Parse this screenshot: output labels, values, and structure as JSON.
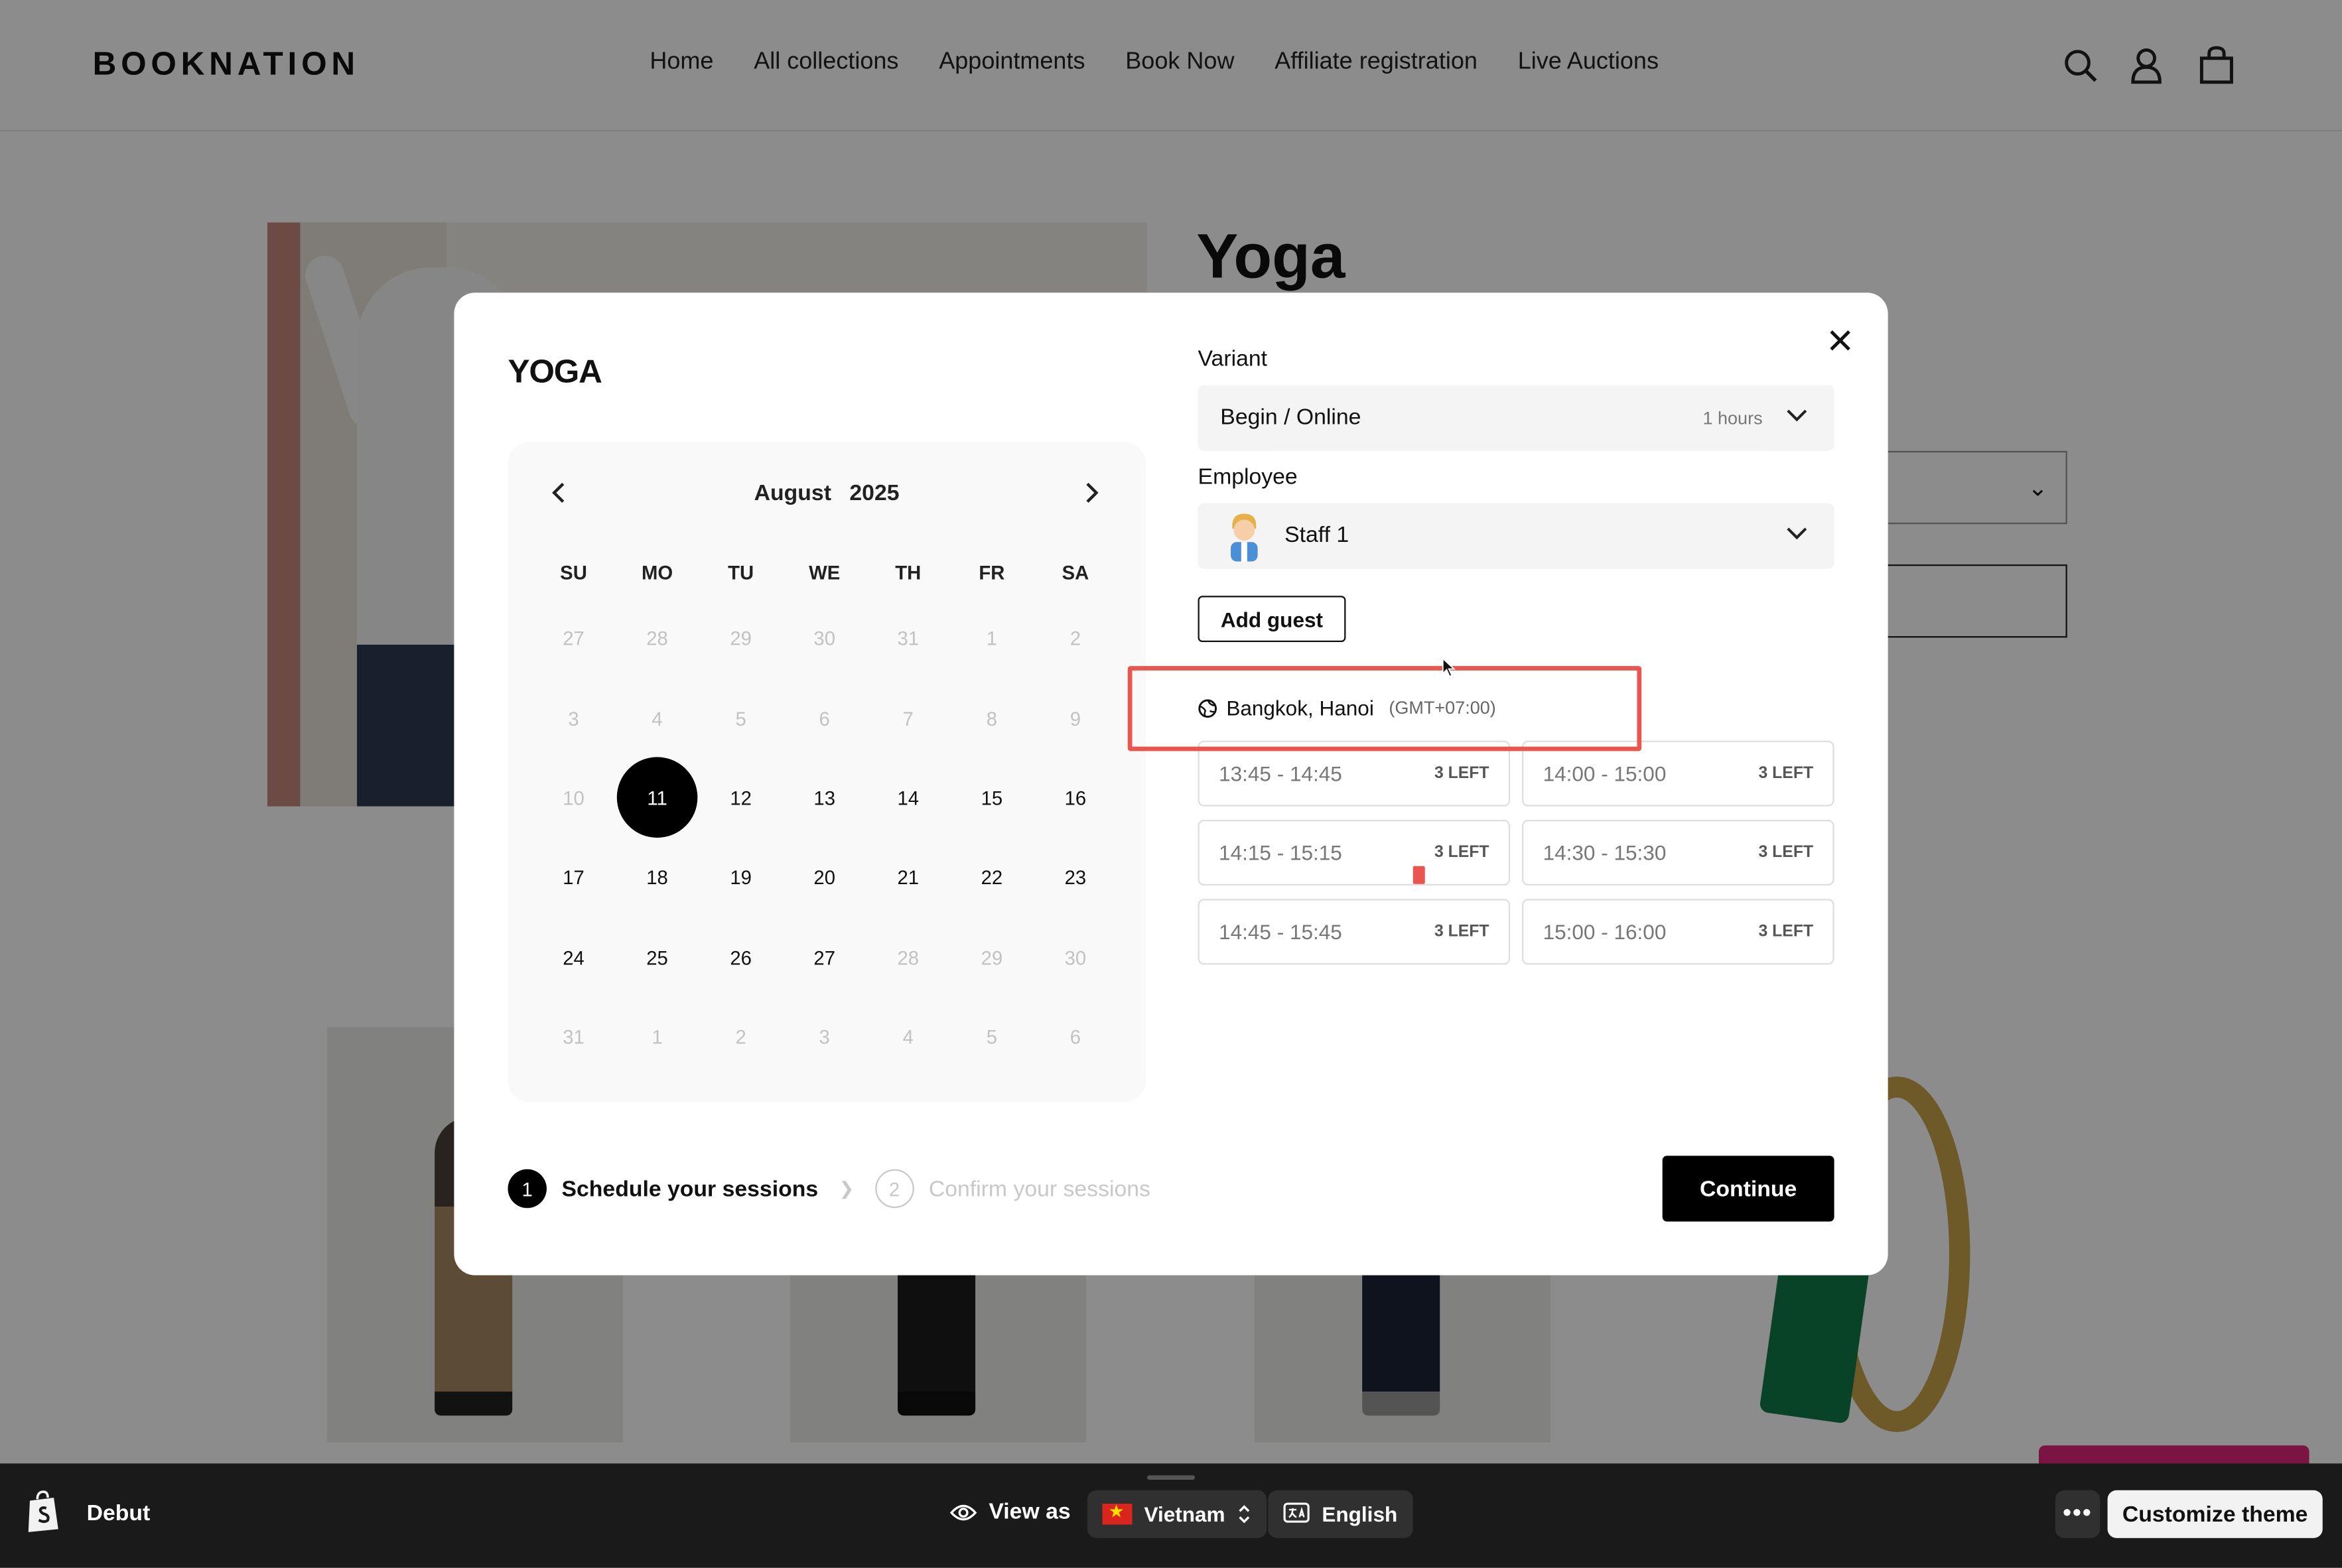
{
  "store": {
    "logo": "BOOKNATION",
    "nav": [
      "Home",
      "All collections",
      "Appointments",
      "Book Now",
      "Affiliate registration",
      "Live Auctions"
    ],
    "product_title": "Yoga"
  },
  "modal": {
    "title": "YOGA",
    "calendar": {
      "month": "August",
      "year": "2025",
      "weekdays": [
        "SU",
        "MO",
        "TU",
        "WE",
        "TH",
        "FR",
        "SA"
      ],
      "days": [
        {
          "d": "27",
          "m": true
        },
        {
          "d": "28",
          "m": true
        },
        {
          "d": "29",
          "m": true
        },
        {
          "d": "30",
          "m": true
        },
        {
          "d": "31",
          "m": true
        },
        {
          "d": "1",
          "m": true
        },
        {
          "d": "2",
          "m": true
        },
        {
          "d": "3",
          "m": true
        },
        {
          "d": "4",
          "m": true
        },
        {
          "d": "5",
          "m": true
        },
        {
          "d": "6",
          "m": true
        },
        {
          "d": "7",
          "m": true
        },
        {
          "d": "8",
          "m": true
        },
        {
          "d": "9",
          "m": true
        },
        {
          "d": "10",
          "m": true
        },
        {
          "d": "11",
          "sel": true
        },
        {
          "d": "12"
        },
        {
          "d": "13"
        },
        {
          "d": "14"
        },
        {
          "d": "15"
        },
        {
          "d": "16"
        },
        {
          "d": "17"
        },
        {
          "d": "18"
        },
        {
          "d": "19"
        },
        {
          "d": "20"
        },
        {
          "d": "21"
        },
        {
          "d": "22"
        },
        {
          "d": "23"
        },
        {
          "d": "24"
        },
        {
          "d": "25"
        },
        {
          "d": "26"
        },
        {
          "d": "27"
        },
        {
          "d": "28",
          "m": true
        },
        {
          "d": "29",
          "m": true
        },
        {
          "d": "30",
          "m": true
        },
        {
          "d": "31",
          "m": true
        },
        {
          "d": "1",
          "m": true
        },
        {
          "d": "2",
          "m": true
        },
        {
          "d": "3",
          "m": true
        },
        {
          "d": "4",
          "m": true
        },
        {
          "d": "5",
          "m": true
        },
        {
          "d": "6",
          "m": true
        }
      ]
    },
    "variant_label": "Variant",
    "variant_value": "Begin / Online",
    "variant_duration": "1 hours",
    "employee_label": "Employee",
    "employee_value": "Staff 1",
    "add_guest": "Add guest",
    "timezone": "Bangkok, Hanoi",
    "timezone_offset": "(GMT+07:00)",
    "slots": [
      {
        "time": "13:45 - 14:45",
        "left": "3 LEFT"
      },
      {
        "time": "14:00 - 15:00",
        "left": "3 LEFT"
      },
      {
        "time": "14:15 - 15:15",
        "left": "3 LEFT"
      },
      {
        "time": "14:30 - 15:30",
        "left": "3 LEFT"
      },
      {
        "time": "14:45 - 15:45",
        "left": "3 LEFT"
      },
      {
        "time": "15:00 - 16:00",
        "left": "3 LEFT"
      }
    ],
    "step1_num": "1",
    "step1_label": "Schedule your sessions",
    "step2_num": "2",
    "step2_label": "Confirm your sessions",
    "continue": "Continue"
  },
  "preview_bar": {
    "theme": "Debut",
    "view_as": "View as",
    "country": "Vietnam",
    "language": "English",
    "customize": "Customize theme"
  },
  "colors": {
    "accent": "#000000",
    "highlight": "#e8564f",
    "bar_bg": "#1a1a1a"
  }
}
